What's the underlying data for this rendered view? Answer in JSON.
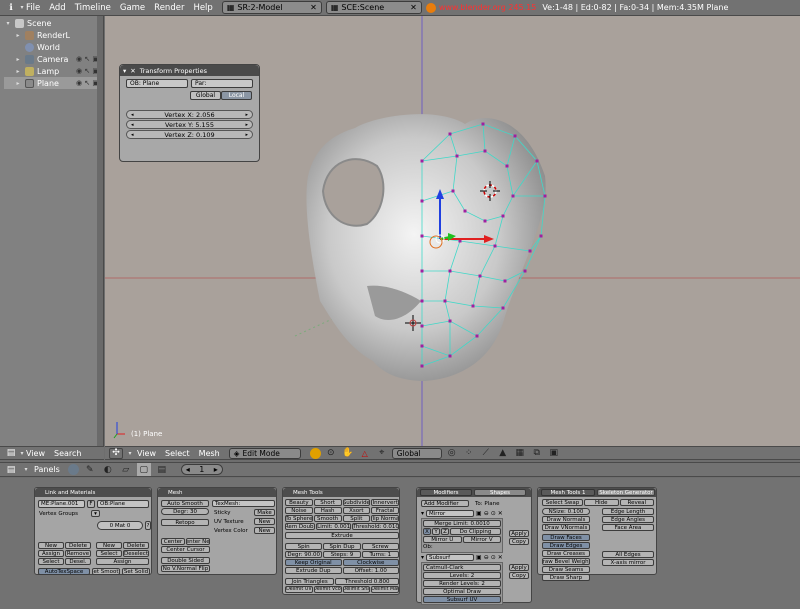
{
  "topbar": {
    "menus": [
      "File",
      "Add",
      "Timeline",
      "Game",
      "Render",
      "Help"
    ],
    "screen": "SR:2-Model",
    "scene": "SCE:Scene",
    "url": "www.blender.org 245.15",
    "stats": "Ve:1-48 | Ed:0-82 | Fa:0-34 | Mem:4.35M Plane"
  },
  "outliner": {
    "items": [
      {
        "label": "Scene",
        "depth": 0,
        "color": "#c8c8c8"
      },
      {
        "label": "RenderL",
        "depth": 1,
        "color": "#a08060"
      },
      {
        "label": "World",
        "depth": 1,
        "color": "#8090b0"
      },
      {
        "label": "Camera",
        "depth": 1,
        "color": "#6a7a8a"
      },
      {
        "label": "Lamp",
        "depth": 1,
        "color": "#c0b060"
      },
      {
        "label": "Plane",
        "depth": 1,
        "color": "#8a8a8a"
      }
    ],
    "header_menus": [
      "View",
      "Search"
    ]
  },
  "transform": {
    "title": "Transform Properties",
    "ob": "OB: Plane",
    "par": "Par:",
    "global": "Global",
    "local": "Local",
    "vx": "Vertex X: 2.056",
    "vy": "Vertex Y: 5.155",
    "vz": "Vertex Z: 0.109"
  },
  "viewport": {
    "label": "(1) Plane",
    "header_menus": [
      "View",
      "Select",
      "Mesh"
    ],
    "mode": "Edit Mode",
    "orientation": "Global"
  },
  "buttons_header": {
    "panels": "Panels",
    "frame": "1"
  },
  "links": {
    "title": "Link and Materials",
    "me": "ME:Plane.001",
    "f": "F",
    "ob": "OB:Plane",
    "vgroups": "Vertex Groups",
    "mat": "0 Mat 0",
    "new": "New",
    "delete": "Delete",
    "assign": "Assign",
    "remove": "Remove",
    "select": "Select",
    "deselect": "Desel.",
    "new2": "New",
    "delete2": "Delete",
    "select2": "Select",
    "deselect2": "Deselect",
    "assign2": "Assign",
    "autotex": "AutoTexSpace",
    "setsmooth": "Set Smooth",
    "setsolid": "Set Solid"
  },
  "mesh": {
    "title": "Mesh",
    "autosmooth": "Auto Smooth",
    "degr": "Degr: 30",
    "retopo": "Retopo",
    "texmesh": "TexMesh:",
    "sticky": "Sticky",
    "make": "Make",
    "uvtex": "UV Texture",
    "new": "New",
    "vcol": "Vertex Color",
    "new2": "New",
    "center": "Center",
    "centernew": "Center New",
    "centercursor": "Center Cursor",
    "doublesided": "Double Sided",
    "novnormal": "No V.Normal Flip"
  },
  "meshtools": {
    "title": "Mesh Tools",
    "row1": [
      "Beauty",
      "Short",
      "Subdivide",
      "Innervert"
    ],
    "row2": [
      "Noise",
      "Hash",
      "Xsort",
      "Fractal"
    ],
    "row3": [
      "To Sphere",
      "Smooth",
      "Split",
      "Flip Normal"
    ],
    "row4": [
      "Rem Doubl",
      "Limit: 0.001",
      "Threshold: 0.010"
    ],
    "extrude": "Extrude",
    "spin": "Spin",
    "spindup": "Spin Dup",
    "screw": "Screw",
    "degr": "Degr: 90.00",
    "steps": "Steps: 9",
    "turns": "Turns: 1",
    "keeporig": "Keep Original",
    "clockwise": "Clockwise",
    "extrudedup": "Extrude Dup",
    "offset": "Offset: 1.00",
    "jointri": "Join Triangles",
    "threshold": "Threshold 0.800",
    "row_last": [
      "Delimit UV",
      "Delimit Vcol",
      "Delimit Sha",
      "Delimit Mat"
    ]
  },
  "modifiers": {
    "tab1": "Modifiers",
    "tab2": "Shapes",
    "add": "Add Modifier",
    "to": "To: Plane",
    "mirror": "Mirror",
    "merge": "Merge Limit: 0.0010",
    "axes": [
      "X",
      "Y",
      "Z"
    ],
    "doclip": "Do Clipping",
    "mirroru": "Mirror U",
    "mirrorv": "Mirror V",
    "ob": "Ob:",
    "apply": "Apply",
    "copy": "Copy",
    "subsurf": "Subsurf",
    "catmull": "Catmull-Clark",
    "levels": "Levels: 2",
    "render": "Render Levels: 2",
    "optimal": "Optimal Draw",
    "subsurfuv": "Subsurf UV",
    "apply2": "Apply",
    "copy2": "Copy"
  },
  "meshtools1": {
    "tab1": "Mesh Tools 1",
    "tab2": "Skeleton Generator",
    "selswap": "Select Swap",
    "hide": "Hide",
    "reveal": "Reveal",
    "nsize": "NSize: 0.100",
    "drawnormals": "Draw Normals",
    "drawvnormals": "Draw VNormals",
    "edgelength": "Edge Length",
    "edgeangles": "Edge Angles",
    "facearea": "Face Area",
    "drawfaces": "Draw Faces",
    "drawedges": "Draw Edges",
    "drawcreases": "Draw Creases",
    "drawbevel": "Draw Bevel Weights",
    "drawseams": "Draw Seams",
    "drawsharp": "Draw Sharp",
    "alledges": "All Edges",
    "xaxis": "X-axis mirror"
  }
}
